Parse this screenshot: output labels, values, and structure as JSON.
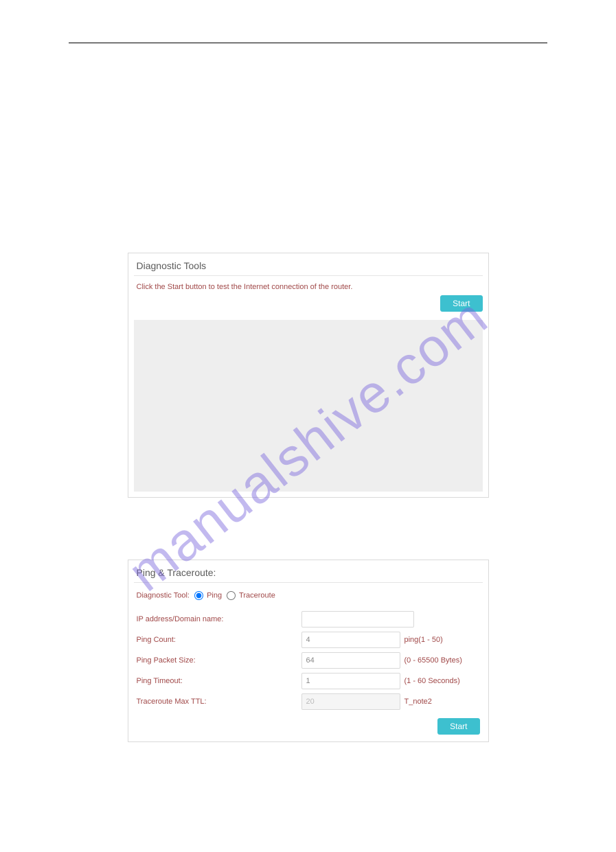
{
  "link": "",
  "watermark": "manualshive.com",
  "card1": {
    "title": "Diagnostic Tools",
    "instruction": "Click the Start button to test the Internet connection of the router.",
    "start_label": "Start"
  },
  "card2": {
    "title": "Ping & Traceroute:",
    "tool_label": "Diagnostic Tool:",
    "ping_label": "Ping",
    "traceroute_label": "Traceroute",
    "rows": {
      "ip": {
        "label": "IP address/Domain name:",
        "value": "",
        "hint": ""
      },
      "count": {
        "label": "Ping Count:",
        "value": "4",
        "hint": "ping(1 - 50)"
      },
      "size": {
        "label": "Ping Packet Size:",
        "value": "64",
        "hint": "(0 - 65500 Bytes)"
      },
      "timeout": {
        "label": "Ping Timeout:",
        "value": "1",
        "hint": "(1 - 60 Seconds)"
      },
      "ttl": {
        "label": "Traceroute Max TTL:",
        "value": "20",
        "hint": "T_note2"
      }
    },
    "start_label": "Start"
  }
}
